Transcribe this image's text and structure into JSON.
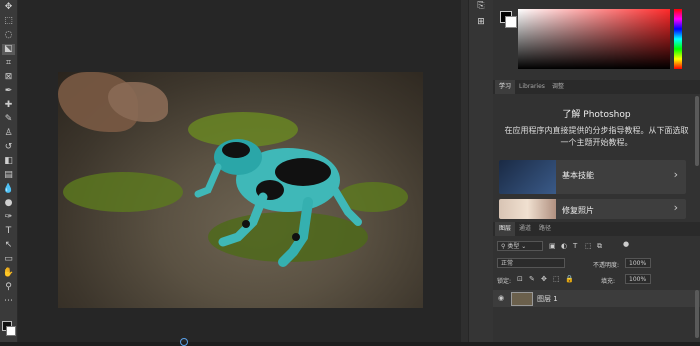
{
  "toolbar": {
    "tools": [
      {
        "name": "move-tool-icon",
        "glyph": "✥"
      },
      {
        "name": "marquee-tool-icon",
        "glyph": "⬚"
      },
      {
        "name": "lasso-tool-icon",
        "glyph": "◌"
      },
      {
        "name": "object-select-tool-icon",
        "glyph": "⬕"
      },
      {
        "name": "crop-tool-icon",
        "glyph": "⌗"
      },
      {
        "name": "frame-tool-icon",
        "glyph": "⊠"
      },
      {
        "name": "eyedropper-tool-icon",
        "glyph": "✒"
      },
      {
        "name": "healing-brush-icon",
        "glyph": "✚"
      },
      {
        "name": "brush-tool-icon",
        "glyph": "✎"
      },
      {
        "name": "clone-stamp-icon",
        "glyph": "♙"
      },
      {
        "name": "history-brush-icon",
        "glyph": "↺"
      },
      {
        "name": "eraser-tool-icon",
        "glyph": "◧"
      },
      {
        "name": "gradient-tool-icon",
        "glyph": "▤"
      },
      {
        "name": "blur-tool-icon",
        "glyph": "💧"
      },
      {
        "name": "dodge-tool-icon",
        "glyph": "●"
      },
      {
        "name": "pen-tool-icon",
        "glyph": "✑"
      },
      {
        "name": "type-tool-icon",
        "glyph": "T"
      },
      {
        "name": "path-select-tool-icon",
        "glyph": "↖"
      },
      {
        "name": "rectangle-tool-icon",
        "glyph": "▭"
      },
      {
        "name": "hand-tool-icon",
        "glyph": "✋"
      },
      {
        "name": "zoom-tool-icon",
        "glyph": "⚲"
      },
      {
        "name": "more-tools-icon",
        "glyph": "⋯"
      }
    ]
  },
  "learn": {
    "tabs": [
      "学习",
      "Libraries",
      "调整"
    ],
    "title": "了解 Photoshop",
    "description": "在应用程序内直接提供的分步指导教程。从下面选取一个主题开始教程。",
    "courses": [
      {
        "label": "基本技能",
        "chevron": "›"
      },
      {
        "label": "修复照片",
        "chevron": "›"
      }
    ]
  },
  "layers": {
    "tabs": [
      "图层",
      "通道",
      "路径"
    ],
    "filter_type": "类型",
    "blend_mode": "正常",
    "opacity_label": "不透明度:",
    "opacity_value": "100%",
    "lock_label": "锁定:",
    "fill_label": "填充:",
    "fill_value": "100%",
    "layer_name": "图层 1"
  },
  "colors": {
    "accent": "#5aa0e8",
    "panel_bg": "#323232",
    "canvas_bg": "#262626"
  }
}
